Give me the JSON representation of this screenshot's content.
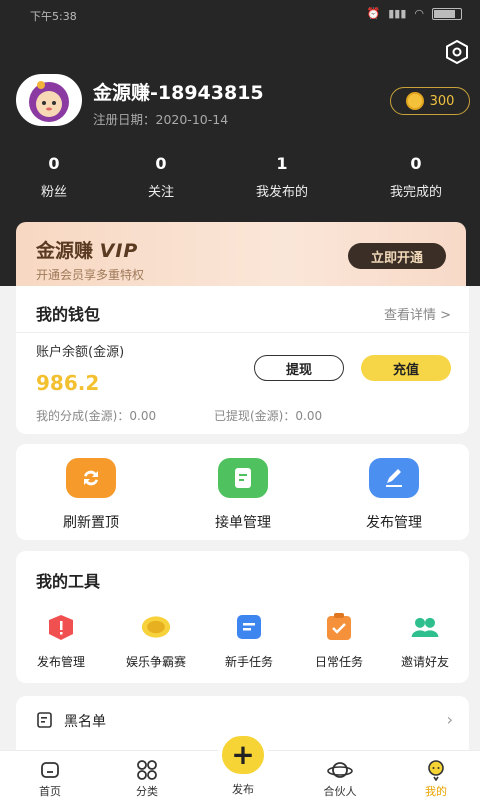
{
  "status": {
    "time": "下午5:38"
  },
  "profile": {
    "name": "金源赚-18943815",
    "reg_date": "注册日期：2020-10-14",
    "coins": "300"
  },
  "stats": [
    {
      "num": "0",
      "label": "粉丝"
    },
    {
      "num": "0",
      "label": "关注"
    },
    {
      "num": "1",
      "label": "我发布的"
    },
    {
      "num": "0",
      "label": "我完成的"
    }
  ],
  "vip": {
    "title": "金源赚",
    "title_vip": "VIP",
    "subtitle": "开通会员享多重特权",
    "button": "立即开通"
  },
  "wallet": {
    "title": "我的钱包",
    "more": "查看详情 >",
    "balance_label": "账户余额(金源)",
    "balance": "986.2",
    "withdraw": "提现",
    "recharge": "充值",
    "share": "我的分成(金源)：0.00",
    "withdrawn": "已提现(金源)：0.00"
  },
  "quick": [
    {
      "label": "刷新置顶",
      "color": "#f59a2b"
    },
    {
      "label": "接单管理",
      "color": "#4fc25f"
    },
    {
      "label": "发布管理",
      "color": "#4b8ff0"
    }
  ],
  "tools": {
    "title": "我的工具",
    "items": [
      {
        "label": "发布管理"
      },
      {
        "label": "娱乐争霸赛"
      },
      {
        "label": "新手任务"
      },
      {
        "label": "日常任务"
      },
      {
        "label": "邀请好友"
      }
    ]
  },
  "blacklist": {
    "label": "黑名单"
  },
  "tabs": [
    {
      "label": "首页"
    },
    {
      "label": "分类"
    },
    {
      "label": "发布"
    },
    {
      "label": "合伙人"
    },
    {
      "label": "我的"
    }
  ]
}
